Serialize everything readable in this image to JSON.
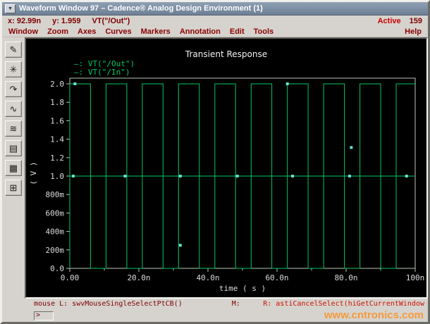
{
  "window": {
    "title": "Waveform Window 97 – Cadence® Analog Design Environment (1)",
    "menu_glyph": "▼"
  },
  "info_bar": {
    "x": "x: 92.99n",
    "y": "y: 1.959",
    "trace": "VT(\"/Out\")",
    "active_label": "Active",
    "active_value": "159"
  },
  "menu": {
    "items": [
      "Window",
      "Zoom",
      "Axes",
      "Curves",
      "Markers",
      "Annotation",
      "Edit",
      "Tools"
    ],
    "help": "Help"
  },
  "toolbar": {
    "buttons": [
      {
        "name": "pen-tool",
        "glyph": "✎"
      },
      {
        "name": "zoom-fit-tool",
        "glyph": "✳"
      },
      {
        "name": "pan-tool",
        "glyph": "↷"
      },
      {
        "name": "slope-marker-tool",
        "glyph": "∿"
      },
      {
        "name": "waveform-tool",
        "glyph": "≋"
      },
      {
        "name": "strip-chart-tool",
        "glyph": "▤"
      },
      {
        "name": "grid-tool",
        "glyph": "▦"
      },
      {
        "name": "subwindow-tool",
        "glyph": "⊞"
      }
    ]
  },
  "chart_data": {
    "type": "line",
    "title": "Transient Response",
    "xlabel": "time ( s )",
    "ylabel": "( V )",
    "xlim": [
      0,
      100
    ],
    "ylim": [
      0,
      2.0
    ],
    "x_unit": "n",
    "grid": false,
    "legend_position": "top-left",
    "x_ticks": [
      {
        "v": 0,
        "label": "0.00"
      },
      {
        "v": 20,
        "label": "20.0n"
      },
      {
        "v": 40,
        "label": "40.0n"
      },
      {
        "v": 60,
        "label": "60.0n"
      },
      {
        "v": 80,
        "label": "80.0n"
      },
      {
        "v": 100,
        "label": "100n"
      }
    ],
    "x_minor": [
      10,
      30,
      50,
      70,
      90
    ],
    "y_ticks": [
      {
        "v": 0,
        "label": "0.0"
      },
      {
        "v": 0.2,
        "label": "200m"
      },
      {
        "v": 0.4,
        "label": "400m"
      },
      {
        "v": 0.6,
        "label": "600m"
      },
      {
        "v": 0.8,
        "label": "800m"
      },
      {
        "v": 1.0,
        "label": "1.0"
      },
      {
        "v": 1.2,
        "label": "1.2"
      },
      {
        "v": 1.4,
        "label": "1.4"
      },
      {
        "v": 1.6,
        "label": "1.6"
      },
      {
        "v": 1.8,
        "label": "1.8"
      },
      {
        "v": 2.0,
        "label": "2.0"
      }
    ],
    "series": [
      {
        "name": "VT(\"/Out\")",
        "legend": "–: VT(\"/Out\")",
        "color": "#00c864",
        "points": [
          [
            0,
            0
          ],
          [
            0,
            2
          ],
          [
            6,
            2
          ],
          [
            6,
            0
          ],
          [
            10.5,
            0
          ],
          [
            10.5,
            2
          ],
          [
            16.5,
            2
          ],
          [
            16.5,
            0
          ],
          [
            21,
            0
          ],
          [
            21,
            2
          ],
          [
            27,
            2
          ],
          [
            27,
            0
          ],
          [
            31.5,
            0
          ],
          [
            31.5,
            2
          ],
          [
            37.5,
            2
          ],
          [
            37.5,
            0
          ],
          [
            42,
            0
          ],
          [
            42,
            2
          ],
          [
            48,
            2
          ],
          [
            48,
            0
          ],
          [
            52.5,
            0
          ],
          [
            52.5,
            2
          ],
          [
            58.5,
            2
          ],
          [
            58.5,
            0
          ],
          [
            63,
            0
          ],
          [
            63,
            2
          ],
          [
            69,
            2
          ],
          [
            69,
            0
          ],
          [
            73.5,
            0
          ],
          [
            73.5,
            2
          ],
          [
            79.5,
            2
          ],
          [
            79.5,
            0
          ],
          [
            84,
            0
          ],
          [
            84,
            2
          ],
          [
            90,
            2
          ],
          [
            90,
            0
          ],
          [
            94.5,
            0
          ],
          [
            94.5,
            2
          ],
          [
            100,
            2
          ]
        ]
      },
      {
        "name": "VT(\"/In\")",
        "legend": "–: VT(\"/In\")",
        "color": "#00c864",
        "points": [
          [
            0,
            1
          ],
          [
            100,
            1
          ]
        ]
      }
    ],
    "markers": {
      "color": "#66e0cc",
      "points": [
        [
          1,
          1
        ],
        [
          16,
          1
        ],
        [
          32,
          1
        ],
        [
          48.5,
          1
        ],
        [
          64.5,
          1
        ],
        [
          81,
          1
        ],
        [
          97.5,
          1
        ],
        [
          1.5,
          2
        ],
        [
          63,
          2
        ],
        [
          32,
          0.25
        ],
        [
          81.5,
          1.31
        ]
      ]
    }
  },
  "status_bar": {
    "mouse_l": "mouse L:  swvMouseSingleSelectPtCB()",
    "m": "M:",
    "r": "R: astiCancelSelect(hiGetCurrentWindow"
  },
  "prompt": {
    "value": ">"
  },
  "watermark": "www.cntronics.com",
  "colors": {
    "axis": "#b9c4b9",
    "trace_green": "#00c864",
    "marker_teal": "#66e0cc",
    "plot_bg": "#000000"
  }
}
